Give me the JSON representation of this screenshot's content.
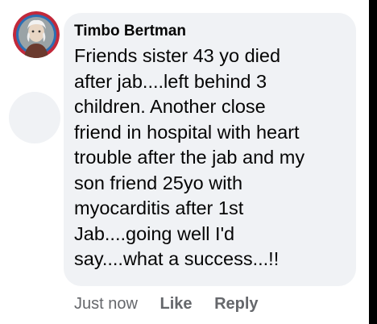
{
  "comment": {
    "author": "Timbo Bertman",
    "lines": [
      "Friends sister 43 yo died",
      "after jab....left behind 3",
      "children. Another close",
      "friend in hospital with heart",
      "trouble after the jab and my",
      "son friend 25yo with",
      "myocarditis after 1st",
      "Jab....going well I'd",
      "say....what a success...!!"
    ]
  },
  "actions": {
    "timestamp": "Just now",
    "like_label": "Like",
    "reply_label": "Reply"
  },
  "icons": {
    "avatar": "profile-photo-icon"
  },
  "colors": {
    "bubble_bg": "#f0f2f5",
    "text": "#050505",
    "secondary_text": "#65676b"
  }
}
